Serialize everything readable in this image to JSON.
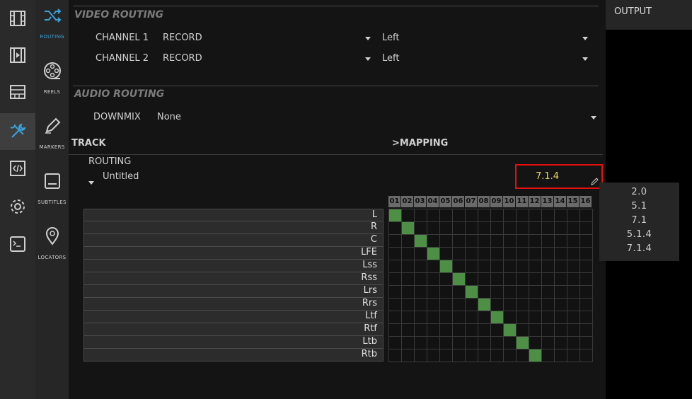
{
  "sidebar_primary": {
    "items": [
      {
        "icon": "film-strip-icon"
      },
      {
        "icon": "film-play-icon"
      },
      {
        "icon": "storage-icon"
      },
      {
        "icon": "tools-icon"
      },
      {
        "icon": "code-icon"
      },
      {
        "icon": "gear-icon"
      },
      {
        "icon": "terminal-icon"
      }
    ]
  },
  "sidebar_secondary": {
    "items": [
      {
        "label": "ROUTING",
        "icon": "shuffle-icon"
      },
      {
        "label": "REELS",
        "icon": "film-reel-icon"
      },
      {
        "label": "MARKERS",
        "icon": "pencil-icon"
      },
      {
        "label": "SUBTITLES",
        "icon": "subtitles-icon"
      },
      {
        "label": "LOCATORS",
        "icon": "location-pin-icon"
      }
    ]
  },
  "video_routing": {
    "title": "VIDEO ROUTING",
    "channel1": {
      "label": "CHANNEL 1",
      "value": "RECORD",
      "side": "Left"
    },
    "channel2": {
      "label": "CHANNEL 2",
      "value": "RECORD",
      "side": "Left"
    }
  },
  "audio_routing": {
    "title": "AUDIO ROUTING",
    "downmix_label": "DOWNMIX",
    "downmix_value": "None"
  },
  "track_header": {
    "track": "TRACK",
    "mapping": ">MAPPING"
  },
  "routing": {
    "label": "ROUTING",
    "name": "Untitled",
    "mapping_value": "7.1.4"
  },
  "matrix": {
    "columns": [
      "01",
      "02",
      "03",
      "04",
      "05",
      "06",
      "07",
      "08",
      "09",
      "10",
      "11",
      "12",
      "13",
      "14",
      "15",
      "16"
    ],
    "rows": [
      "L",
      "R",
      "C",
      "LFE",
      "Lss",
      "Rss",
      "Lrs",
      "Rrs",
      "Ltf",
      "Rtf",
      "Ltb",
      "Rtb"
    ],
    "active": [
      1,
      2,
      3,
      4,
      5,
      6,
      7,
      8,
      9,
      10,
      11,
      12
    ]
  },
  "output": {
    "title": "OUTPUT"
  },
  "mapping_dropdown": {
    "options": [
      "2.0",
      "5.1",
      "7.1",
      "5.1.4",
      "7.1.4"
    ]
  },
  "colors": {
    "accent_blue": "#3aa3dc",
    "active_cell": "#4e8f46",
    "highlight_border": "#e01010",
    "mapping_value_text": "#e8d26a"
  }
}
